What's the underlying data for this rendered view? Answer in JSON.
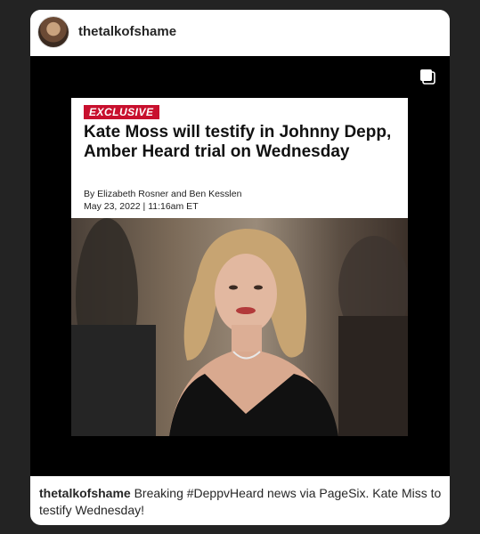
{
  "post": {
    "username": "thetalkofshame",
    "avatar_icon": "profile-avatar",
    "carousel_icon": "multiple-images-icon"
  },
  "article": {
    "badge": "EXCLUSIVE",
    "headline": "Kate Moss will testify in Johnny Depp, Amber Heard trial on Wednesday",
    "byline": "By Elizabeth Rosner and Ben Kesslen",
    "date": "May 23, 2022 | 11:16am ET",
    "badge_color": "#c8102e"
  },
  "caption": {
    "username": "thetalkofshame",
    "text": "Breaking #DeppvHeard news via PageSix. Kate Miss to testify Wednesday!"
  }
}
